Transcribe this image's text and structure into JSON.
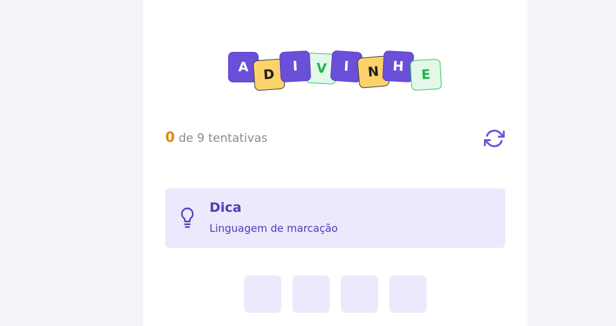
{
  "logo": {
    "letters": [
      "A",
      "D",
      "I",
      "V",
      "I",
      "N",
      "H",
      "E"
    ]
  },
  "attempts": {
    "count": "0",
    "label": "de 9 tentativas"
  },
  "hint": {
    "title": "Dica",
    "text": "Linguagem de marcação"
  },
  "colors": {
    "accent": "#6c4fd8",
    "yellow": "#fcd36a",
    "green": "#34c35c",
    "attempt_count": "#e08a14",
    "hint_background": "#ebe9fb"
  },
  "answer_slots": 4
}
